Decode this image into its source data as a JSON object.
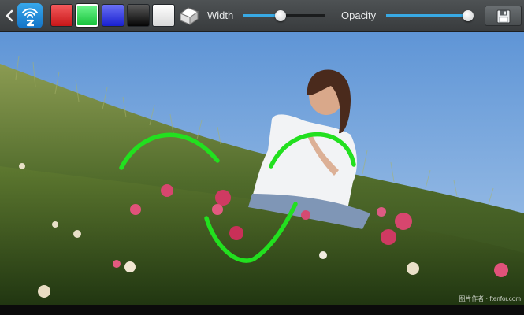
{
  "toolbar": {
    "width_label": "Width",
    "opacity_label": "Opacity",
    "width_value": 0.45,
    "opacity_value": 1.0,
    "colors": [
      {
        "name": "red",
        "hex": "#e8262a",
        "selected": false
      },
      {
        "name": "green",
        "hex": "#22e04a",
        "selected": true
      },
      {
        "name": "blue",
        "hex": "#2330e0",
        "selected": false
      },
      {
        "name": "black",
        "hex": "#101010",
        "selected": false
      },
      {
        "name": "white",
        "hex": "#f4f4f4",
        "selected": false
      }
    ],
    "icons": [
      "back-arrow-icon",
      "app-logo-icon",
      "eraser-icon",
      "save-icon"
    ]
  },
  "canvas": {
    "stroke_color": "#22e01f",
    "watermark": "图片作者 · ftenfor.com"
  }
}
